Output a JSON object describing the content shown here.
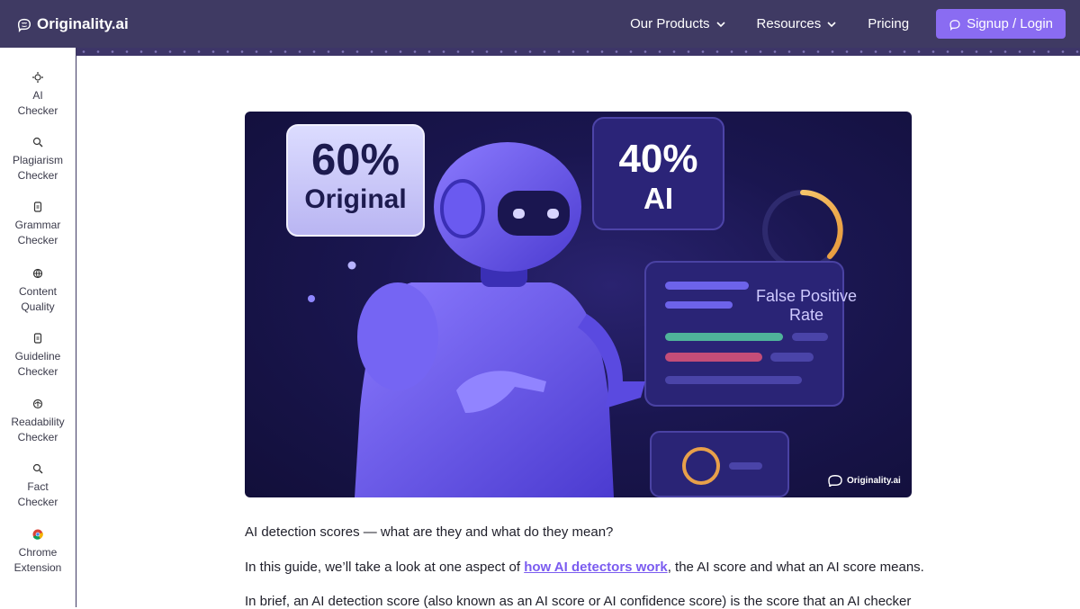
{
  "header": {
    "brand": "Originality.ai",
    "nav": {
      "products": "Our Products",
      "resources": "Resources",
      "pricing": "Pricing"
    },
    "signup": "Signup / Login"
  },
  "sidebar": {
    "items": [
      {
        "line1": "AI",
        "line2": "Checker",
        "icon": "sparkle-icon"
      },
      {
        "line1": "Plagiarism",
        "line2": "Checker",
        "icon": "search-icon"
      },
      {
        "line1": "Grammar",
        "line2": "Checker",
        "icon": "document-icon"
      },
      {
        "line1": "Content",
        "line2": "Quality",
        "icon": "globe-icon"
      },
      {
        "line1": "Guideline",
        "line2": "Checker",
        "icon": "document-icon"
      },
      {
        "line1": "Readability",
        "line2": "Checker",
        "icon": "brain-icon"
      },
      {
        "line1": "Fact",
        "line2": "Checker",
        "icon": "search-icon"
      },
      {
        "line1": "Chrome",
        "line2": "Extension",
        "icon": "chrome-icon"
      }
    ]
  },
  "hero": {
    "original_pct": "60%",
    "original_label": "Original",
    "ai_pct": "40%",
    "ai_label": "AI",
    "fpr_line1": "False Positive",
    "fpr_line2": "Rate",
    "watermark": "Originality.ai"
  },
  "article": {
    "p1": "AI detection scores — what are they and what do they mean?",
    "p2_before": "In this guide, we’ll take a look at one aspect of ",
    "p2_link": "how AI detectors work",
    "p2_after": ", the AI score and what an AI score means.",
    "p3": "In brief, an AI detection score (also known as an AI score or AI confidence score) is the score that an AI checker"
  },
  "colors": {
    "header_bg": "#3f3a63",
    "accent": "#8a6cf2",
    "link": "#7b5cf0"
  }
}
